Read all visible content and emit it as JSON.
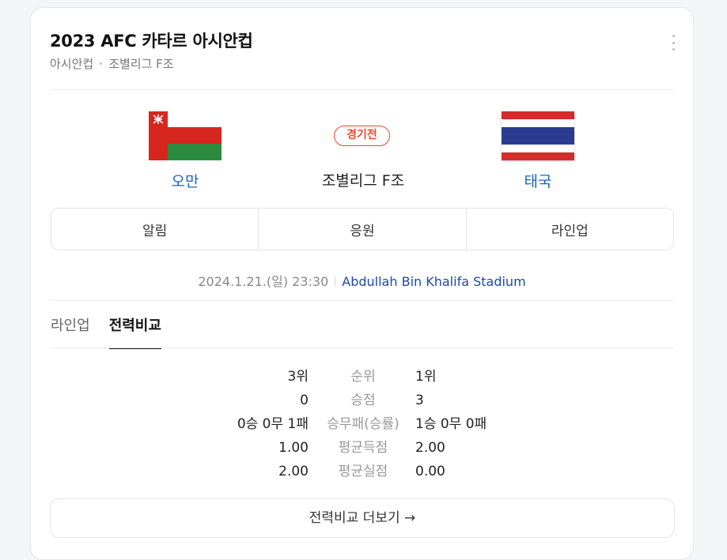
{
  "header": {
    "title": "2023 AFC 카타르 아시안컵",
    "breadcrumb": [
      "아시안컵",
      "조별리그 F조"
    ]
  },
  "match": {
    "home_team": "오만",
    "away_team": "태국",
    "status": "경기전",
    "league": "조별리그 F조",
    "datetime": "2024.1.21.(일) 23:30",
    "venue": "Abdullah Bin Khalifa Stadium"
  },
  "actions": [
    "알림",
    "응원",
    "라인업"
  ],
  "tabs": [
    {
      "label": "라인업",
      "active": false
    },
    {
      "label": "전력비교",
      "active": true
    }
  ],
  "comparison": [
    {
      "home": "3위",
      "label": "순위",
      "away": "1위"
    },
    {
      "home": "0",
      "label": "승점",
      "away": "3"
    },
    {
      "home": "0승 0무 1패",
      "label": "승무패(승률)",
      "away": "1승 0무 0패"
    },
    {
      "home": "1.00",
      "label": "평균득점",
      "away": "2.00"
    },
    {
      "home": "2.00",
      "label": "평균실점",
      "away": "0.00"
    }
  ],
  "more_button": "전력비교 더보기 →",
  "colors": {
    "accent_blue": "#1b62c6",
    "status_red": "#f0472b",
    "oman_red": "#d7261e",
    "oman_green": "#2a8a3e",
    "thailand_red": "#d52b2b",
    "thailand_blue": "#2b3b8f"
  },
  "icons": {
    "more": "more-vertical-icon",
    "home_flag": "oman-flag-icon",
    "away_flag": "thailand-flag-icon"
  }
}
